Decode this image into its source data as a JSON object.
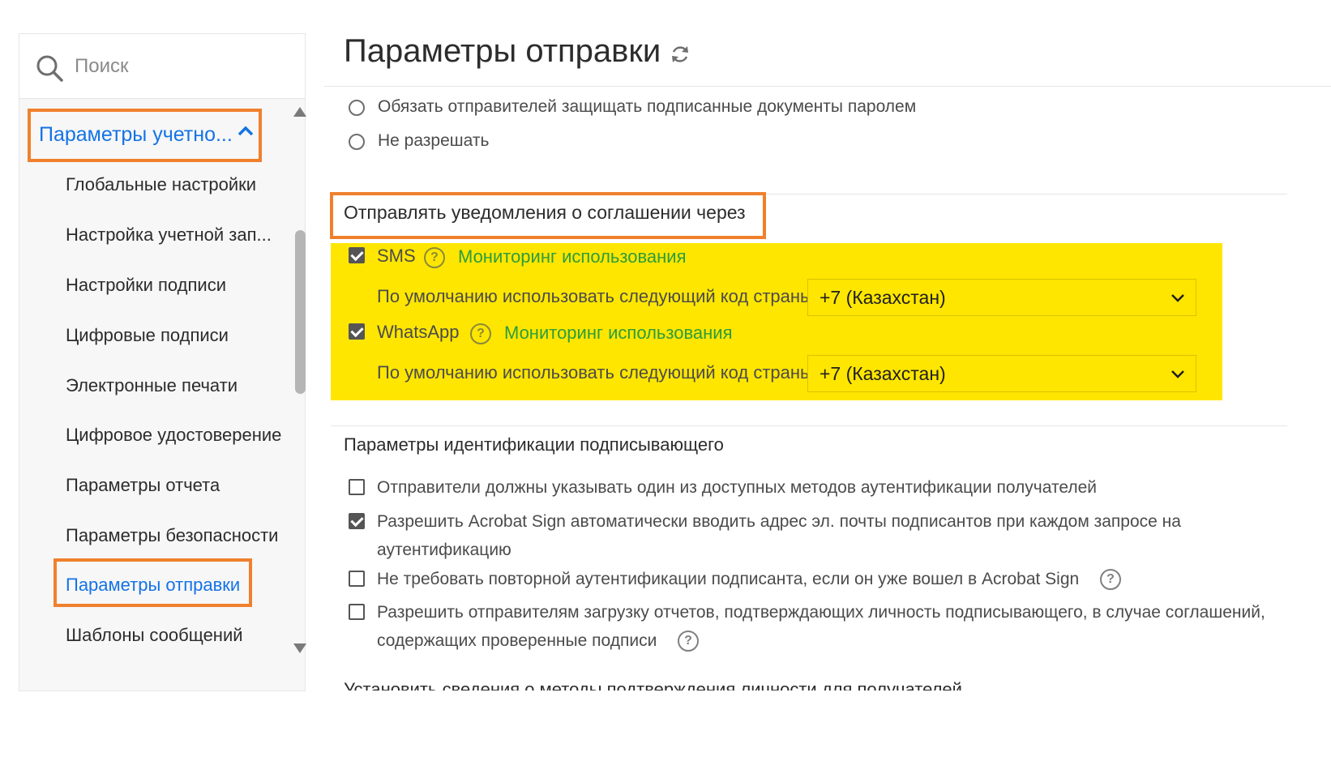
{
  "sidebar": {
    "search_placeholder": "Поиск",
    "group_label": "Параметры учетно...",
    "items": [
      {
        "label": "Глобальные настройки"
      },
      {
        "label": "Настройка учетной зап..."
      },
      {
        "label": "Настройки подписи"
      },
      {
        "label": "Цифровые подписи"
      },
      {
        "label": "Электронные печати"
      },
      {
        "label": "Цифровое удостоверение"
      },
      {
        "label": "Параметры отчета"
      },
      {
        "label": "Параметры безопасности"
      },
      {
        "label": "Параметры отправки",
        "active": true
      },
      {
        "label": "Шаблоны сообщений"
      }
    ]
  },
  "main": {
    "title": "Параметры отправки",
    "password_options": [
      {
        "label": "Обязать отправителей защищать подписанные документы паролем",
        "selected": false
      },
      {
        "label": "Не разрешать",
        "selected": false
      }
    ],
    "notifications": {
      "title": "Отправлять уведомления о соглашении через",
      "channels": [
        {
          "name": "SMS",
          "checked": true,
          "monitor_link": "Мониторинг использования",
          "code_label": "По умолчанию использовать следующий код страны:",
          "code_value": "+7 (Казахстан)"
        },
        {
          "name": "WhatsApp",
          "checked": true,
          "monitor_link": "Мониторинг использования",
          "code_label": "По умолчанию использовать следующий код страны:",
          "code_value": "+7 (Казахстан)"
        }
      ]
    },
    "identity": {
      "title": "Параметры идентификации подписывающего",
      "options": [
        {
          "lines": [
            "Отправители должны указывать один из доступных методов аутентификации получателей"
          ],
          "checked": false
        },
        {
          "lines": [
            "Разрешить Acrobat Sign автоматически вводить адрес эл. почты подписантов при каждом запросе на",
            "аутентификацию"
          ],
          "checked": true
        },
        {
          "lines": [
            "Не требовать повторной аутентификации подписанта, если он уже вошел в Acrobat Sign"
          ],
          "checked": false
        },
        {
          "lines": [
            "Разрешить отправителям загрузку отчетов, подтверждающих личность подписывающего, в случае соглашений,",
            "содержащих проверенные подписи"
          ],
          "checked": false
        }
      ]
    },
    "cut_off_text": "Установить сведения о методы подтверждения личности для получателей"
  },
  "colors": {
    "accent_blue": "#1473e6",
    "highlight_orange": "#f0802d",
    "highlight_yellow": "#ffe600",
    "link_green": "#2d9d3b"
  }
}
